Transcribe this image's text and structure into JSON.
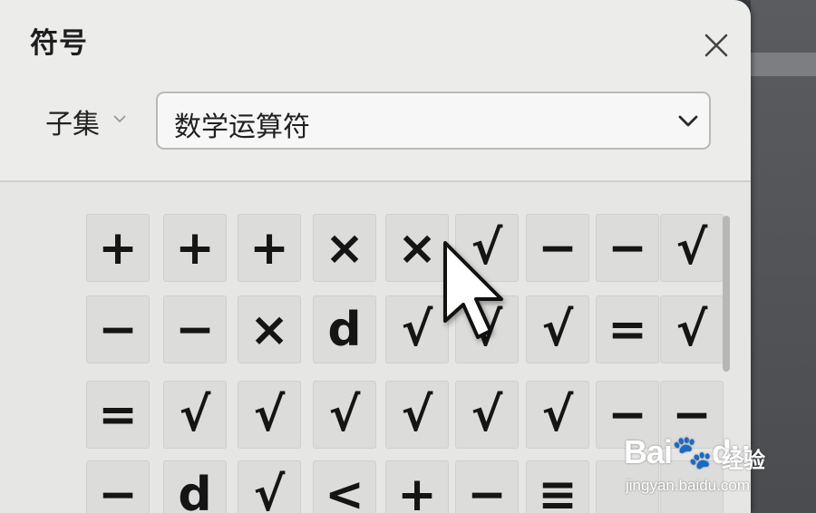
{
  "dialog": {
    "title": "符号"
  },
  "subset": {
    "label": "子集",
    "selected": "数学运算符"
  },
  "grid": {
    "rows": [
      [
        "+",
        "+",
        "+",
        "×",
        "×",
        "√",
        "−",
        "−",
        "√"
      ],
      [
        "−",
        "−",
        "×",
        "d",
        "√",
        "√",
        "√",
        "=",
        "√"
      ],
      [
        "=",
        "√",
        "√",
        "√",
        "√",
        "√",
        "√",
        "−",
        "−"
      ],
      [
        "−",
        "d",
        "√",
        "<",
        "+",
        "−",
        "≡",
        "",
        ""
      ]
    ]
  },
  "watermark": {
    "logo": "Bai🐾du",
    "cn": "经验",
    "url": "jingyan.baidu.com"
  },
  "icons": {
    "close": "close-icon",
    "subset_chevron": "chevron-down-icon",
    "select_chevron": "chevron-down-icon",
    "cursor": "mouse-pointer-icon"
  },
  "colors": {
    "dialog_bg": "#ececeb",
    "cell_bg": "#dcdcdb",
    "outside": "#3b3d40"
  }
}
